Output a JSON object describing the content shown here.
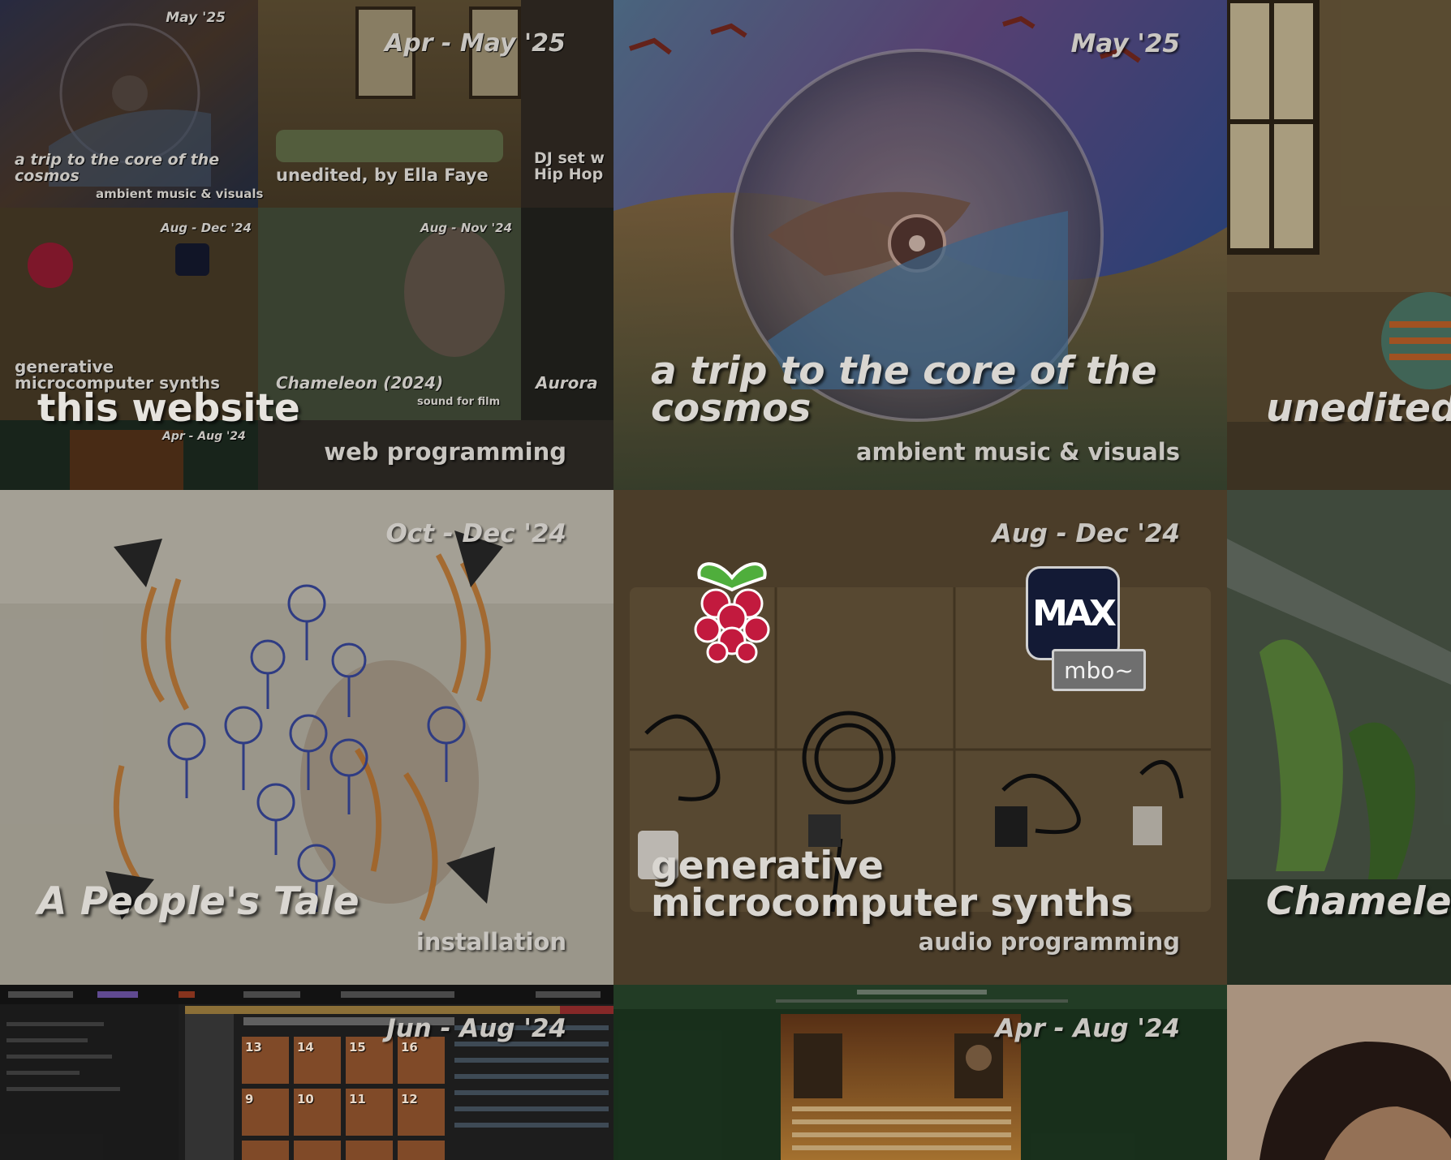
{
  "tiles": {
    "collage": {
      "title": "this website",
      "subtitle": "web programming",
      "mini": [
        {
          "date": "May '25",
          "title_line1": "a trip to the core of the",
          "title_line2": "cosmos",
          "subtitle": "ambient music & visuals"
        },
        {
          "date": "Apr - May '25",
          "title": "unedited, by Ella Faye"
        },
        {
          "title_line1": "DJ set w",
          "title_line2": "Hip Hop"
        },
        {
          "date": "Aug - Dec '24",
          "title_line1": "generative",
          "title_line2": "microcomputer synths"
        },
        {
          "date": "Aug - Nov '24",
          "title": "Chameleon (2024)",
          "subtitle": "sound for film"
        },
        {
          "title": "Aurora"
        },
        {
          "date": "Apr - Aug '24"
        }
      ]
    },
    "cosmos": {
      "date": "May '25",
      "title_line1": "a trip to the core of the",
      "title_line2": "cosmos",
      "subtitle": "ambient music & visuals"
    },
    "unedited": {
      "title": "unedited"
    },
    "peoples_tale": {
      "date": "Oct - Dec '24",
      "title": "A People's Tale",
      "subtitle": "installation"
    },
    "synths": {
      "date": "Aug - Dec '24",
      "title_line1": "generative",
      "title_line2": "microcomputer synths",
      "subtitle": "audio programming",
      "max_logo": "MAX",
      "max_badge": "mbo~"
    },
    "chameleon": {
      "title": "Chamele"
    },
    "daw": {
      "date": "Jun - Aug '24",
      "clip_numbers_top": [
        "13",
        "14",
        "15",
        "16"
      ],
      "clip_numbers_bottom": [
        "9",
        "10",
        "11",
        "12"
      ]
    },
    "studio": {
      "date": "Apr - Aug '24"
    },
    "portrait": {}
  },
  "colors": {
    "background": "#1c1d18",
    "text": "#d9d6d1",
    "studio_green": "#1e3a22"
  }
}
